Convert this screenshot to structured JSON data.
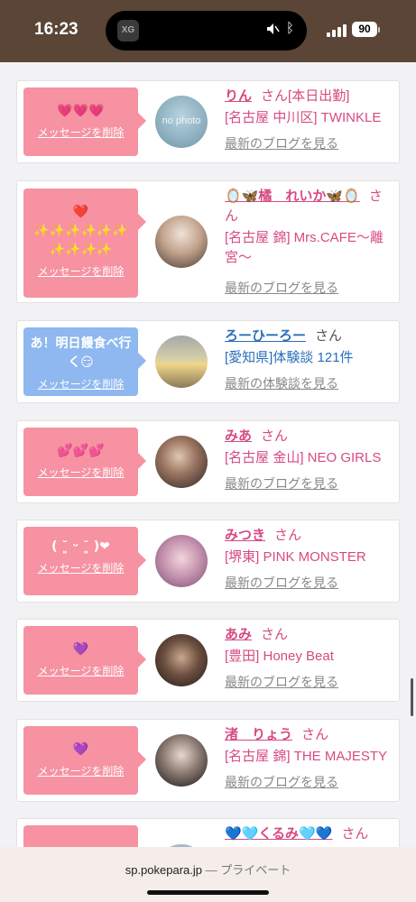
{
  "status_bar": {
    "time": "16:23",
    "battery": "90",
    "island_app": "XG"
  },
  "cards": [
    {
      "message": "💗💗💗",
      "delete_label": "メッセージを削除",
      "name": "りん",
      "suffix": "さん",
      "extra": "[本日出勤]",
      "shop": "[名古屋 中川区] TWINKLE",
      "link": "最新のブログを見る",
      "avatar_text": "no photo",
      "color": "pink"
    },
    {
      "message": "❤️\n✨✨✨✨✨✨\n✨✨✨✨",
      "delete_label": "メッセージを削除",
      "name": "🪞🦋橘　れいか🦋🪞",
      "suffix": "さん",
      "extra": "",
      "shop": "[名古屋 錦] Mrs.CAFE〜離宮〜",
      "link": "最新のブログを見る",
      "avatar_text": "",
      "color": "pink"
    },
    {
      "message": "あ！明日饅食べ行く😏",
      "delete_label": "メッセージを削除",
      "name": "ろーひーろー",
      "suffix": "さん",
      "extra": "",
      "shop": "[愛知県]体験談 121件",
      "link": "最新の体験談を見る",
      "avatar_text": "",
      "color": "blue"
    },
    {
      "message": "💕💕💕",
      "delete_label": "メッセージを削除",
      "name": "みあ",
      "suffix": "さん",
      "extra": "",
      "shop": "[名古屋 金山] NEO GIRLS",
      "link": "最新のブログを見る",
      "avatar_text": "",
      "color": "pink"
    },
    {
      "message": "( ˘͈ ᵕ ˘͈ )❤",
      "delete_label": "メッセージを削除",
      "name": "みつき",
      "suffix": "さん",
      "extra": "",
      "shop": "[堺東] PINK MONSTER",
      "link": "最新のブログを見る",
      "avatar_text": "",
      "color": "pink"
    },
    {
      "message": "💜",
      "delete_label": "メッセージを削除",
      "name": "あみ",
      "suffix": "さん",
      "extra": "",
      "shop": "[豊田] Honey Beat",
      "link": "最新のブログを見る",
      "avatar_text": "",
      "color": "pink"
    },
    {
      "message": "💜",
      "delete_label": "メッセージを削除",
      "name": "渚　りょう",
      "suffix": "さん",
      "extra": "",
      "shop": "[名古屋 錦] THE MAJESTY",
      "link": "最新のブログを見る",
      "avatar_text": "",
      "color": "pink"
    },
    {
      "message": "",
      "delete_label": "",
      "name": "💙🩵くるみ🩵💙",
      "suffix": "さん",
      "extra": "",
      "shop": "",
      "link": "",
      "avatar_text": "",
      "color": "pink"
    }
  ],
  "address_bar": {
    "domain": "sp.pokepara.jp",
    "separator": "—",
    "mode": "プライベート"
  },
  "colors": {
    "accent": "#d74a82",
    "bubble_pink": "#f692a2",
    "bubble_blue": "#8eb8ef",
    "status_bar": "#5a4536"
  }
}
